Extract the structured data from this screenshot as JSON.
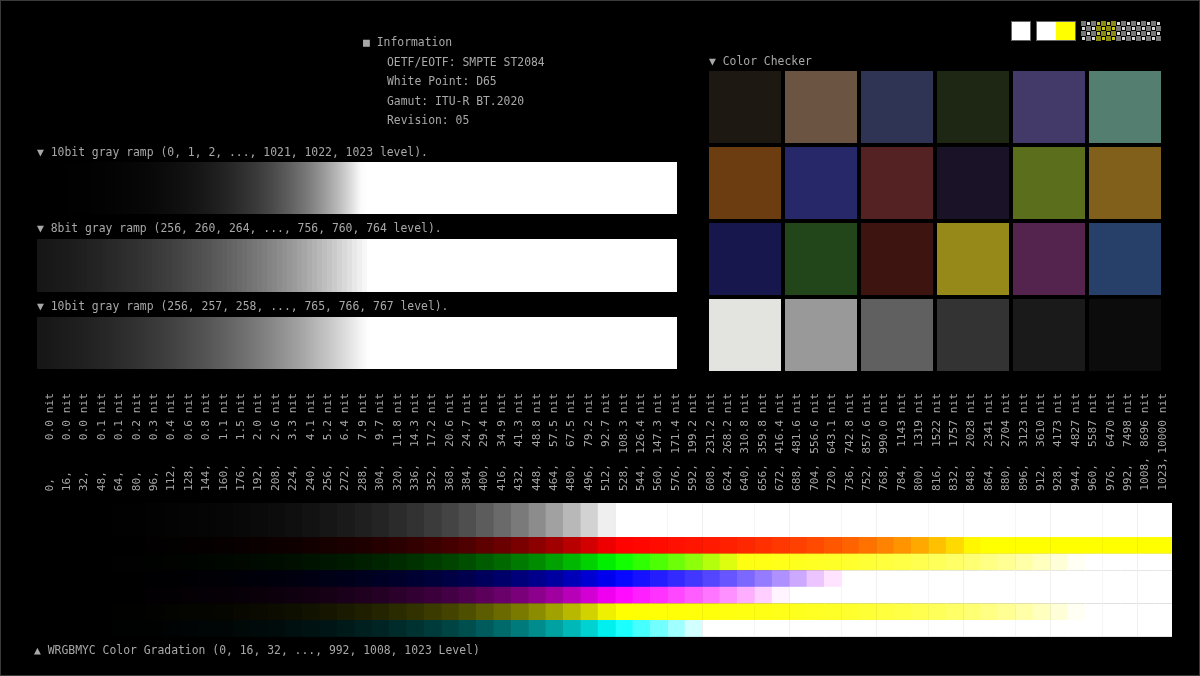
{
  "info": {
    "title": "■ Information",
    "lines": [
      "OETF/EOTF: SMPTE ST2084",
      "White Point: D65",
      "Gamut: ITU-R BT.2020",
      "Revision: 05"
    ]
  },
  "ramps": [
    {
      "label": "▼ 10bit gray ramp (0, 1, 2, ..., 1021, 1022, 1023 level).",
      "kind": "full"
    },
    {
      "label": "▼ 8bit gray ramp (256, 260, 264, ..., 756, 760, 764 level).",
      "kind": "banded"
    },
    {
      "label": "▼ 10bit gray ramp (256, 257, 258, ..., 765, 766, 767 level).",
      "kind": "mid"
    }
  ],
  "color_checker": {
    "title": "▼ Color Checker",
    "patches": [
      {
        "color": "#1e1812"
      },
      {
        "color": "#6c5442"
      },
      {
        "color": "#2f3454"
      },
      {
        "color": "#1e2614"
      },
      {
        "color": "#433a6a"
      },
      {
        "color": "#547e70"
      },
      {
        "color": "#6d3d12"
      },
      {
        "color": "#27286a"
      },
      {
        "color": "#552224"
      },
      {
        "color": "#1a1226"
      },
      {
        "color": "#5a6e1c"
      },
      {
        "color": "#80601a"
      },
      {
        "color": "#17174e"
      },
      {
        "color": "#23451a"
      },
      {
        "color": "#3e1410"
      },
      {
        "color": "#97881a"
      },
      {
        "color": "#55244e"
      },
      {
        "color": "#26406a"
      },
      {
        "color": "#e3e4df"
      },
      {
        "color": "#999999"
      },
      {
        "color": "#606060"
      },
      {
        "color": "#333333"
      },
      {
        "color": "#1a1a1a"
      },
      {
        "color": "#0c0c0c"
      }
    ]
  },
  "gradation": {
    "title": "▲ WRGBMYC Color Gradation (0, 16, 32, ..., 992, 1008, 1023 Level)",
    "labels": [
      {
        "level": "0,",
        "nits": "0.0 nit"
      },
      {
        "level": "16,",
        "nits": "0.0 nit"
      },
      {
        "level": "32,",
        "nits": "0.0 nit"
      },
      {
        "level": "48,",
        "nits": "0.1 nit"
      },
      {
        "level": "64,",
        "nits": "0.1 nit"
      },
      {
        "level": "80,",
        "nits": "0.2 nit"
      },
      {
        "level": "96,",
        "nits": "0.3 nit"
      },
      {
        "level": "112,",
        "nits": "0.4 nit"
      },
      {
        "level": "128,",
        "nits": "0.6 nit"
      },
      {
        "level": "144,",
        "nits": "0.8 nit"
      },
      {
        "level": "160,",
        "nits": "1.1 nit"
      },
      {
        "level": "176,",
        "nits": "1.5 nit"
      },
      {
        "level": "192,",
        "nits": "2.0 nit"
      },
      {
        "level": "208,",
        "nits": "2.6 nit"
      },
      {
        "level": "224,",
        "nits": "3.3 nit"
      },
      {
        "level": "240,",
        "nits": "4.1 nit"
      },
      {
        "level": "256,",
        "nits": "5.2 nit"
      },
      {
        "level": "272,",
        "nits": "6.4 nit"
      },
      {
        "level": "288,",
        "nits": "7.9 nit"
      },
      {
        "level": "304,",
        "nits": "9.7 nit"
      },
      {
        "level": "320,",
        "nits": "11.8 nit"
      },
      {
        "level": "336,",
        "nits": "14.3 nit"
      },
      {
        "level": "352,",
        "nits": "17.2 nit"
      },
      {
        "level": "368,",
        "nits": "20.6 nit"
      },
      {
        "level": "384,",
        "nits": "24.7 nit"
      },
      {
        "level": "400,",
        "nits": "29.4 nit"
      },
      {
        "level": "416,",
        "nits": "34.9 nit"
      },
      {
        "level": "432,",
        "nits": "41.3 nit"
      },
      {
        "level": "448,",
        "nits": "48.8 nit"
      },
      {
        "level": "464,",
        "nits": "57.5 nit"
      },
      {
        "level": "480,",
        "nits": "67.5 nit"
      },
      {
        "level": "496,",
        "nits": "79.2 nit"
      },
      {
        "level": "512,",
        "nits": "92.7 nit"
      },
      {
        "level": "528,",
        "nits": "108.3 nit"
      },
      {
        "level": "544,",
        "nits": "126.4 nit"
      },
      {
        "level": "560,",
        "nits": "147.3 nit"
      },
      {
        "level": "576,",
        "nits": "171.4 nit"
      },
      {
        "level": "592,",
        "nits": "199.2 nit"
      },
      {
        "level": "608,",
        "nits": "231.2 nit"
      },
      {
        "level": "624,",
        "nits": "268.2 nit"
      },
      {
        "level": "640,",
        "nits": "310.8 nit"
      },
      {
        "level": "656,",
        "nits": "359.8 nit"
      },
      {
        "level": "672,",
        "nits": "416.4 nit"
      },
      {
        "level": "688,",
        "nits": "481.6 nit"
      },
      {
        "level": "704,",
        "nits": "556.6 nit"
      },
      {
        "level": "720,",
        "nits": "643.1 nit"
      },
      {
        "level": "736,",
        "nits": "742.8 nit"
      },
      {
        "level": "752,",
        "nits": "857.6 nit"
      },
      {
        "level": "768,",
        "nits": "990.0 nit"
      },
      {
        "level": "784,",
        "nits": "1143 nit"
      },
      {
        "level": "800,",
        "nits": "1319 nit"
      },
      {
        "level": "816,",
        "nits": "1522 nit"
      },
      {
        "level": "832,",
        "nits": "1757 nit"
      },
      {
        "level": "848,",
        "nits": "2028 nit"
      },
      {
        "level": "864,",
        "nits": "2341 nit"
      },
      {
        "level": "880,",
        "nits": "2704 nit"
      },
      {
        "level": "896,",
        "nits": "3123 nit"
      },
      {
        "level": "912,",
        "nits": "3610 nit"
      },
      {
        "level": "928,",
        "nits": "4173 nit"
      },
      {
        "level": "944,",
        "nits": "4827 nit"
      },
      {
        "level": "960,",
        "nits": "5587 nit"
      },
      {
        "level": "976,",
        "nits": "6470 nit"
      },
      {
        "level": "992,",
        "nits": "7498 nit"
      },
      {
        "level": "1008,",
        "nits": "8696 nit"
      },
      {
        "level": "1023,",
        "nits": "10000 nit"
      }
    ]
  }
}
